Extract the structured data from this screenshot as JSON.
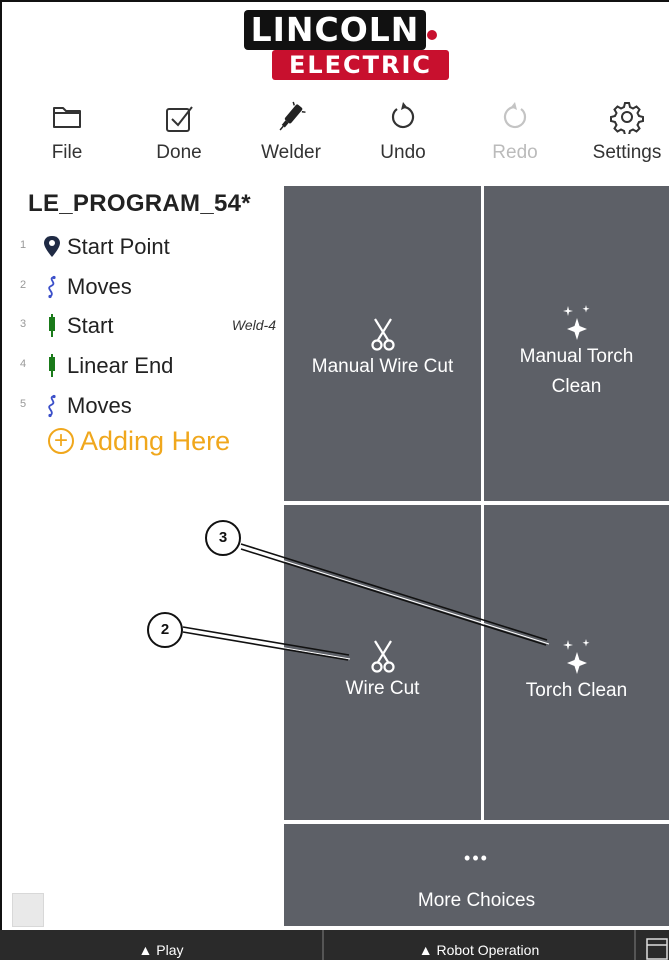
{
  "brand": {
    "line1": "LINCOLN",
    "line2": "ELECTRIC"
  },
  "toolbar": {
    "file_label": "File",
    "done_label": "Done",
    "welder_label": "Welder",
    "undo_label": "Undo",
    "redo_label": "Redo",
    "settings_label": "Settings"
  },
  "program": {
    "title": "LE_PROGRAM_54*",
    "items": [
      {
        "num": "1",
        "icon": "location-pin-icon",
        "label": "Start Point",
        "tag": ""
      },
      {
        "num": "2",
        "icon": "squiggle-moves-icon",
        "label": "Moves",
        "tag": ""
      },
      {
        "num": "3",
        "icon": "torch-start-icon",
        "label": "Start",
        "tag": "Weld-4"
      },
      {
        "num": "4",
        "icon": "torch-end-icon",
        "label": "Linear End",
        "tag": ""
      },
      {
        "num": "5",
        "icon": "squiggle-moves-icon",
        "label": "Moves",
        "tag": ""
      }
    ],
    "adding_label": "Adding Here",
    "adding_color": "#f0a71c"
  },
  "choices": {
    "manual_wire_cut": "Manual Wire Cut",
    "manual_torch_clean_line1": "Manual Torch",
    "manual_torch_clean_line2": "Clean",
    "wire_cut": "Wire Cut",
    "torch_clean": "Torch Clean",
    "more_dots": "•••",
    "more_choices": "More Choices",
    "tile_color": "#5d6067"
  },
  "bottombar": {
    "play_label": "▲ Play",
    "robot_operation_label": "▲ Robot Operation"
  },
  "callouts": {
    "c2": "2",
    "c3": "3"
  }
}
